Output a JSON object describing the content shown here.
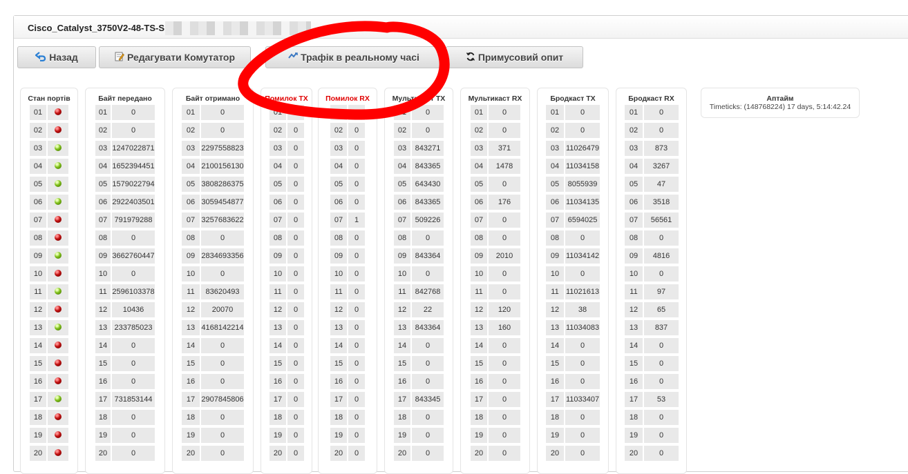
{
  "window": {
    "title": "Cisco_Catalyst_3750V2-48-TS-S"
  },
  "toolbar": {
    "back": "Назад",
    "edit": "Редагувати Комутатор",
    "traffic": "Трафік в реальному часі",
    "poll": "Примусовий опит"
  },
  "uptime": {
    "header": "Аптайм",
    "value": "Timeticks: (148768224) 17 days, 5:14:42.24"
  },
  "colors": {
    "led_on": "#7fbf1a",
    "led_off": "#c01010",
    "error_header": "#e00000",
    "annotation": "#ff0000"
  },
  "ports": [
    "01",
    "02",
    "03",
    "04",
    "05",
    "06",
    "07",
    "08",
    "09",
    "10",
    "11",
    "12",
    "13",
    "14",
    "15",
    "16",
    "17",
    "18",
    "19",
    "20"
  ],
  "columns": {
    "status": {
      "header": "Стан портів",
      "values": [
        "down",
        "down",
        "up",
        "up",
        "up",
        "up",
        "down",
        "down",
        "up",
        "down",
        "up",
        "down",
        "up",
        "down",
        "down",
        "down",
        "up",
        "down",
        "down",
        "down"
      ]
    },
    "bytes_tx": {
      "header": "Байт передано",
      "values": [
        "0",
        "0",
        "1247022871",
        "1652394451",
        "1579022794",
        "2922403501",
        "791979288",
        "0",
        "3662760447",
        "0",
        "2596103378",
        "10436",
        "233785023",
        "0",
        "0",
        "0",
        "731853144",
        "0",
        "0",
        "0"
      ]
    },
    "bytes_rx": {
      "header": "Байт отримано",
      "values": [
        "0",
        "0",
        "2297558823",
        "2100156130",
        "3808286375",
        "3059454877",
        "3257683622",
        "0",
        "2834693356",
        "0",
        "83620493",
        "20070",
        "4168142214",
        "0",
        "0",
        "0",
        "2907845806",
        "0",
        "0",
        "0"
      ]
    },
    "errors_tx": {
      "header": "Помилок TX",
      "values": [
        "0",
        "0",
        "0",
        "0",
        "0",
        "0",
        "0",
        "0",
        "0",
        "0",
        "0",
        "0",
        "0",
        "0",
        "0",
        "0",
        "0",
        "0",
        "0",
        "0"
      ]
    },
    "errors_rx": {
      "header": "Помилок RX",
      "values": [
        "0",
        "0",
        "0",
        "0",
        "0",
        "0",
        "1",
        "0",
        "0",
        "0",
        "0",
        "0",
        "0",
        "0",
        "0",
        "0",
        "0",
        "0",
        "0",
        "0"
      ]
    },
    "mcast_tx": {
      "header": "Мультикаст TX",
      "values": [
        "0",
        "0",
        "843271",
        "843365",
        "643430",
        "843365",
        "509226",
        "0",
        "843364",
        "0",
        "842768",
        "22",
        "843364",
        "0",
        "0",
        "0",
        "843345",
        "0",
        "0",
        "0"
      ]
    },
    "mcast_rx": {
      "header": "Мультикаст RX",
      "values": [
        "0",
        "0",
        "371",
        "1478",
        "0",
        "176",
        "0",
        "0",
        "2010",
        "0",
        "0",
        "120",
        "160",
        "0",
        "0",
        "0",
        "0",
        "0",
        "0",
        "0"
      ]
    },
    "bcast_tx": {
      "header": "Бродкаст TX",
      "values": [
        "0",
        "0",
        "11026479",
        "11034158",
        "8055939",
        "11034135",
        "6594025",
        "0",
        "11034142",
        "0",
        "11021613",
        "38",
        "11034083",
        "0",
        "0",
        "0",
        "11033407",
        "0",
        "0",
        "0"
      ]
    },
    "bcast_rx": {
      "header": "Бродкаст RX",
      "values": [
        "0",
        "0",
        "873",
        "3267",
        "47",
        "3518",
        "56561",
        "0",
        "4816",
        "0",
        "97",
        "65",
        "837",
        "0",
        "0",
        "0",
        "53",
        "0",
        "0",
        "0"
      ]
    }
  }
}
